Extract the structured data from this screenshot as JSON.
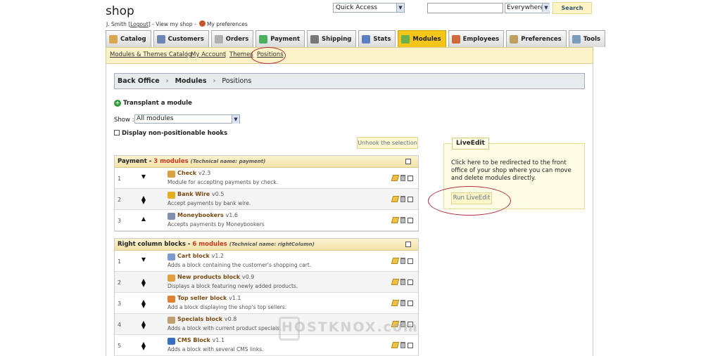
{
  "header": {
    "shop_title": "shop",
    "user_name": "J. Smith",
    "logout_label": "Logout",
    "view_shop_label": "View my shop",
    "prefs_label": "My preferences",
    "quick_access": "Quick Access",
    "search_scope": "Everywhere",
    "search_button": "Search",
    "search_value": ""
  },
  "tabs": [
    {
      "label": "Catalog",
      "color": "#d9a84e"
    },
    {
      "label": "Customers",
      "color": "#6e86b6"
    },
    {
      "label": "Orders",
      "color": "#b0b0b0"
    },
    {
      "label": "Payment",
      "color": "#4caf60"
    },
    {
      "label": "Shipping",
      "color": "#777777"
    },
    {
      "label": "Stats",
      "color": "#5b7fc0"
    },
    {
      "label": "Modules",
      "color": "#6ab04c"
    },
    {
      "label": "Employees",
      "color": "#d06a3a"
    },
    {
      "label": "Preferences",
      "color": "#c0a060"
    },
    {
      "label": "Tools",
      "color": "#7a9ac0"
    }
  ],
  "active_tab": "Modules",
  "subnav": [
    "Modules & Themes Catalog",
    "My Account",
    "Themes",
    "Positions"
  ],
  "breadcrumb": [
    "Back Office",
    "Modules",
    "Positions"
  ],
  "controls": {
    "transplant_label": "Transplant a module",
    "show_label": "Show :",
    "show_value": "All modules",
    "display_np_label": "Display non-positionable hooks",
    "unhook_label": "Unhook the selection"
  },
  "hooks": [
    {
      "title": "Payment",
      "count": "3 modules",
      "tech": "(Technical name: payment)",
      "modules": [
        {
          "pos": "1",
          "name": "Check",
          "ver": "v2.3",
          "desc": "Module for accepting payments by check.",
          "icon": "#d8a040"
        },
        {
          "pos": "2",
          "name": "Bank Wire",
          "ver": "v0.5",
          "desc": "Accept payments by bank wire.",
          "icon": "#e0b020"
        },
        {
          "pos": "3",
          "name": "Moneybookers",
          "ver": "v1.6",
          "desc": "Accepts payments by Moneybookers",
          "icon": "#8090b0"
        }
      ]
    },
    {
      "title": "Right column blocks",
      "count": "6 modules",
      "tech": "(Technical name: rightColumn)",
      "modules": [
        {
          "pos": "1",
          "name": "Cart block",
          "ver": "v1.2",
          "desc": "Adds a block containing the customer's shopping cart.",
          "icon": "#7a9ad0"
        },
        {
          "pos": "2",
          "name": "New products block",
          "ver": "v0.9",
          "desc": "Displays a block featuring newly added products.",
          "icon": "#e0a040"
        },
        {
          "pos": "3",
          "name": "Top seller block",
          "ver": "v1.1",
          "desc": "Add a block displaying the shop's top sellers.",
          "icon": "#e08030"
        },
        {
          "pos": "4",
          "name": "Specials block",
          "ver": "v0.8",
          "desc": "Adds a block with current product specials.",
          "icon": "#c0a070"
        },
        {
          "pos": "5",
          "name": "CMS Block",
          "ver": "v1.1",
          "desc": "Adds a block with several CMS links.",
          "icon": "#3a70c0"
        }
      ]
    }
  ],
  "liveedit": {
    "title": "LiveEdit",
    "text": "Click here to be redirected to the front office of your shop where you can move and delete modules directly.",
    "button": "Run LiveEdit"
  },
  "watermark": "HOSTKNOX.com"
}
